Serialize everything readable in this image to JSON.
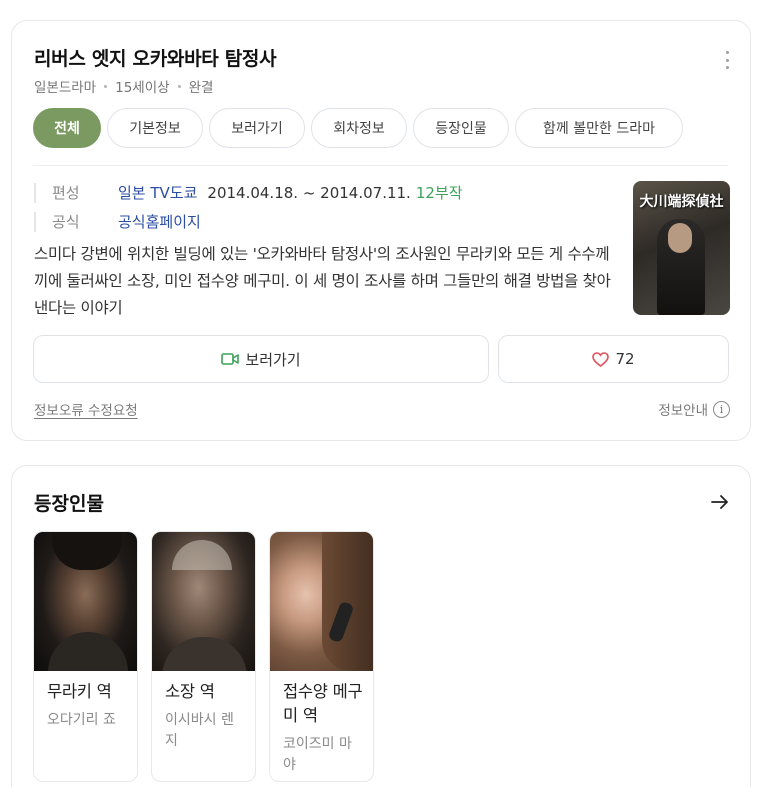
{
  "info": {
    "title": "리버스 엣지 오카와바타 탐정사",
    "meta": [
      "일본드라마",
      "15세이상",
      "완결"
    ],
    "tabs": [
      "전체",
      "기본정보",
      "보러가기",
      "회차정보",
      "등장인물",
      "함께 볼만한 드라마"
    ],
    "fields": {
      "broadcast_label": "편성",
      "broadcast_network": "일본 TV도쿄",
      "broadcast_period": "2014.04.18. ~ 2014.07.11.",
      "episodes": "12부작",
      "official_label": "공식",
      "official_link": "공식홈페이지"
    },
    "synopsis": "스미다 강변에 위치한 빌딩에 있는 '오카와바타 탐정사'의 조사원인 무라키와 모든 게 수수께끼에 둘러싸인 소장, 미인 접수양 메구미. 이 세 명이 조사를 하며 그들만의 해결 방법을 찾아낸다는 이야기",
    "poster_text": "大川端探偵社",
    "watch_button": "보러가기",
    "like_count": "72",
    "report_link": "정보오류 수정요청",
    "info_guide": "정보안내"
  },
  "cast_section": {
    "title": "등장인물",
    "members": [
      {
        "role": "무라키 역",
        "actor": "오다기리 죠"
      },
      {
        "role": "소장 역",
        "actor": "이시바시 렌지"
      },
      {
        "role": "접수양 메구미 역",
        "actor": "코이즈미 마야"
      }
    ]
  },
  "colors": {
    "active_tab": "#7b9a62",
    "link": "#2b4ea3",
    "episodes": "#3fa25a",
    "heart": "#e0505a"
  },
  "icons": [
    "more-vertical-icon",
    "video-camera-icon",
    "heart-icon",
    "info-icon",
    "arrow-right-icon"
  ]
}
